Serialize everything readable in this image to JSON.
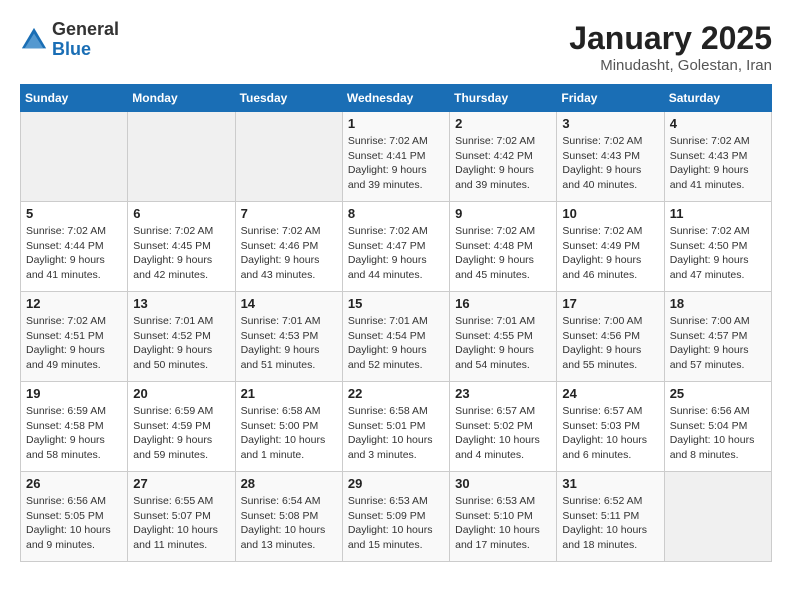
{
  "header": {
    "logo_general": "General",
    "logo_blue": "Blue",
    "title": "January 2025",
    "subtitle": "Minudasht, Golestan, Iran"
  },
  "weekdays": [
    "Sunday",
    "Monday",
    "Tuesday",
    "Wednesday",
    "Thursday",
    "Friday",
    "Saturday"
  ],
  "weeks": [
    [
      {
        "day": "",
        "detail": ""
      },
      {
        "day": "",
        "detail": ""
      },
      {
        "day": "",
        "detail": ""
      },
      {
        "day": "1",
        "detail": "Sunrise: 7:02 AM\nSunset: 4:41 PM\nDaylight: 9 hours and 39 minutes."
      },
      {
        "day": "2",
        "detail": "Sunrise: 7:02 AM\nSunset: 4:42 PM\nDaylight: 9 hours and 39 minutes."
      },
      {
        "day": "3",
        "detail": "Sunrise: 7:02 AM\nSunset: 4:43 PM\nDaylight: 9 hours and 40 minutes."
      },
      {
        "day": "4",
        "detail": "Sunrise: 7:02 AM\nSunset: 4:43 PM\nDaylight: 9 hours and 41 minutes."
      }
    ],
    [
      {
        "day": "5",
        "detail": "Sunrise: 7:02 AM\nSunset: 4:44 PM\nDaylight: 9 hours and 41 minutes."
      },
      {
        "day": "6",
        "detail": "Sunrise: 7:02 AM\nSunset: 4:45 PM\nDaylight: 9 hours and 42 minutes."
      },
      {
        "day": "7",
        "detail": "Sunrise: 7:02 AM\nSunset: 4:46 PM\nDaylight: 9 hours and 43 minutes."
      },
      {
        "day": "8",
        "detail": "Sunrise: 7:02 AM\nSunset: 4:47 PM\nDaylight: 9 hours and 44 minutes."
      },
      {
        "day": "9",
        "detail": "Sunrise: 7:02 AM\nSunset: 4:48 PM\nDaylight: 9 hours and 45 minutes."
      },
      {
        "day": "10",
        "detail": "Sunrise: 7:02 AM\nSunset: 4:49 PM\nDaylight: 9 hours and 46 minutes."
      },
      {
        "day": "11",
        "detail": "Sunrise: 7:02 AM\nSunset: 4:50 PM\nDaylight: 9 hours and 47 minutes."
      }
    ],
    [
      {
        "day": "12",
        "detail": "Sunrise: 7:02 AM\nSunset: 4:51 PM\nDaylight: 9 hours and 49 minutes."
      },
      {
        "day": "13",
        "detail": "Sunrise: 7:01 AM\nSunset: 4:52 PM\nDaylight: 9 hours and 50 minutes."
      },
      {
        "day": "14",
        "detail": "Sunrise: 7:01 AM\nSunset: 4:53 PM\nDaylight: 9 hours and 51 minutes."
      },
      {
        "day": "15",
        "detail": "Sunrise: 7:01 AM\nSunset: 4:54 PM\nDaylight: 9 hours and 52 minutes."
      },
      {
        "day": "16",
        "detail": "Sunrise: 7:01 AM\nSunset: 4:55 PM\nDaylight: 9 hours and 54 minutes."
      },
      {
        "day": "17",
        "detail": "Sunrise: 7:00 AM\nSunset: 4:56 PM\nDaylight: 9 hours and 55 minutes."
      },
      {
        "day": "18",
        "detail": "Sunrise: 7:00 AM\nSunset: 4:57 PM\nDaylight: 9 hours and 57 minutes."
      }
    ],
    [
      {
        "day": "19",
        "detail": "Sunrise: 6:59 AM\nSunset: 4:58 PM\nDaylight: 9 hours and 58 minutes."
      },
      {
        "day": "20",
        "detail": "Sunrise: 6:59 AM\nSunset: 4:59 PM\nDaylight: 9 hours and 59 minutes."
      },
      {
        "day": "21",
        "detail": "Sunrise: 6:58 AM\nSunset: 5:00 PM\nDaylight: 10 hours and 1 minute."
      },
      {
        "day": "22",
        "detail": "Sunrise: 6:58 AM\nSunset: 5:01 PM\nDaylight: 10 hours and 3 minutes."
      },
      {
        "day": "23",
        "detail": "Sunrise: 6:57 AM\nSunset: 5:02 PM\nDaylight: 10 hours and 4 minutes."
      },
      {
        "day": "24",
        "detail": "Sunrise: 6:57 AM\nSunset: 5:03 PM\nDaylight: 10 hours and 6 minutes."
      },
      {
        "day": "25",
        "detail": "Sunrise: 6:56 AM\nSunset: 5:04 PM\nDaylight: 10 hours and 8 minutes."
      }
    ],
    [
      {
        "day": "26",
        "detail": "Sunrise: 6:56 AM\nSunset: 5:05 PM\nDaylight: 10 hours and 9 minutes."
      },
      {
        "day": "27",
        "detail": "Sunrise: 6:55 AM\nSunset: 5:07 PM\nDaylight: 10 hours and 11 minutes."
      },
      {
        "day": "28",
        "detail": "Sunrise: 6:54 AM\nSunset: 5:08 PM\nDaylight: 10 hours and 13 minutes."
      },
      {
        "day": "29",
        "detail": "Sunrise: 6:53 AM\nSunset: 5:09 PM\nDaylight: 10 hours and 15 minutes."
      },
      {
        "day": "30",
        "detail": "Sunrise: 6:53 AM\nSunset: 5:10 PM\nDaylight: 10 hours and 17 minutes."
      },
      {
        "day": "31",
        "detail": "Sunrise: 6:52 AM\nSunset: 5:11 PM\nDaylight: 10 hours and 18 minutes."
      },
      {
        "day": "",
        "detail": ""
      }
    ]
  ]
}
